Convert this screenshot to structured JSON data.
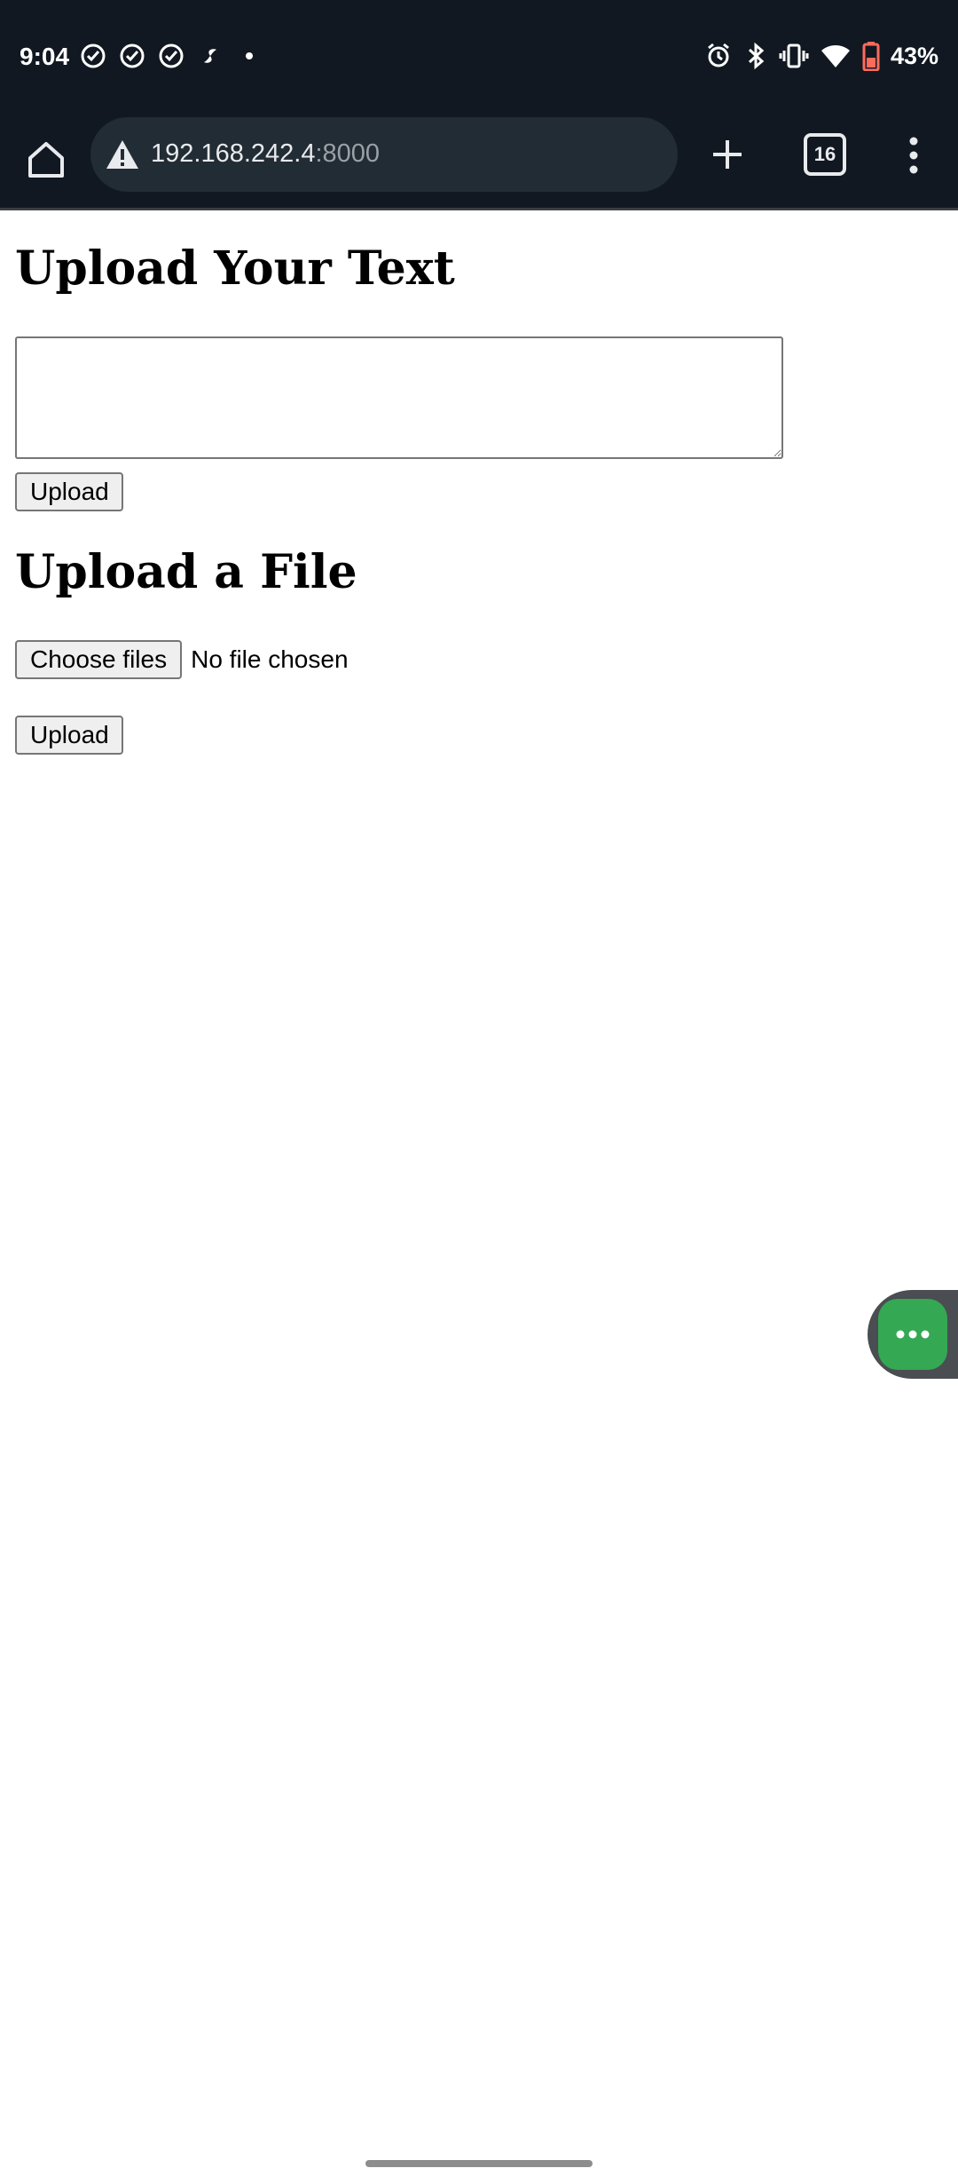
{
  "status_bar": {
    "time": "9:04",
    "battery_percent": "43%",
    "left_icons": [
      "check-circle-icon",
      "check-circle-icon",
      "check-circle-icon",
      "fan-icon",
      "dot-icon"
    ],
    "right_icons": [
      "alarm-icon",
      "bluetooth-icon",
      "vibrate-icon",
      "wifi-icon",
      "battery-icon"
    ]
  },
  "browser": {
    "url_host": "192.168.242.4",
    "url_port": ":8000",
    "tab_count": "16"
  },
  "page": {
    "text_section_title": "Upload Your Text",
    "text_area_value": "",
    "upload_text_button": "Upload",
    "file_section_title": "Upload a File",
    "choose_files_button": "Choose files",
    "file_status": "No file chosen",
    "upload_file_button": "Upload"
  },
  "colors": {
    "chrome_bg": "#111821",
    "urlbar_bg": "#222c34",
    "bubble_green": "#34a853"
  }
}
